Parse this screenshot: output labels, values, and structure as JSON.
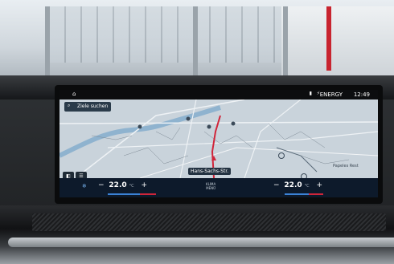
{
  "statusbar": {
    "energy": "ENERGY",
    "time": "12:49"
  },
  "map": {
    "search_label": "Ziele suchen",
    "street_label": "Hans-Sachs-Str.",
    "poi_label": "Papeles Rest"
  },
  "climate": {
    "left_minus": "−",
    "left_temp": "22.0",
    "left_unit": "°C",
    "left_plus": "+",
    "center_label_1": "KLIMA",
    "center_label_2": "MENÜ",
    "right_minus": "−",
    "right_temp": "22.0",
    "right_unit": "°C",
    "right_plus": "+"
  },
  "colors": {
    "route": "#d0253a",
    "climate_bg": "#0d1a2b",
    "accent_blue": "#3b82d6"
  }
}
